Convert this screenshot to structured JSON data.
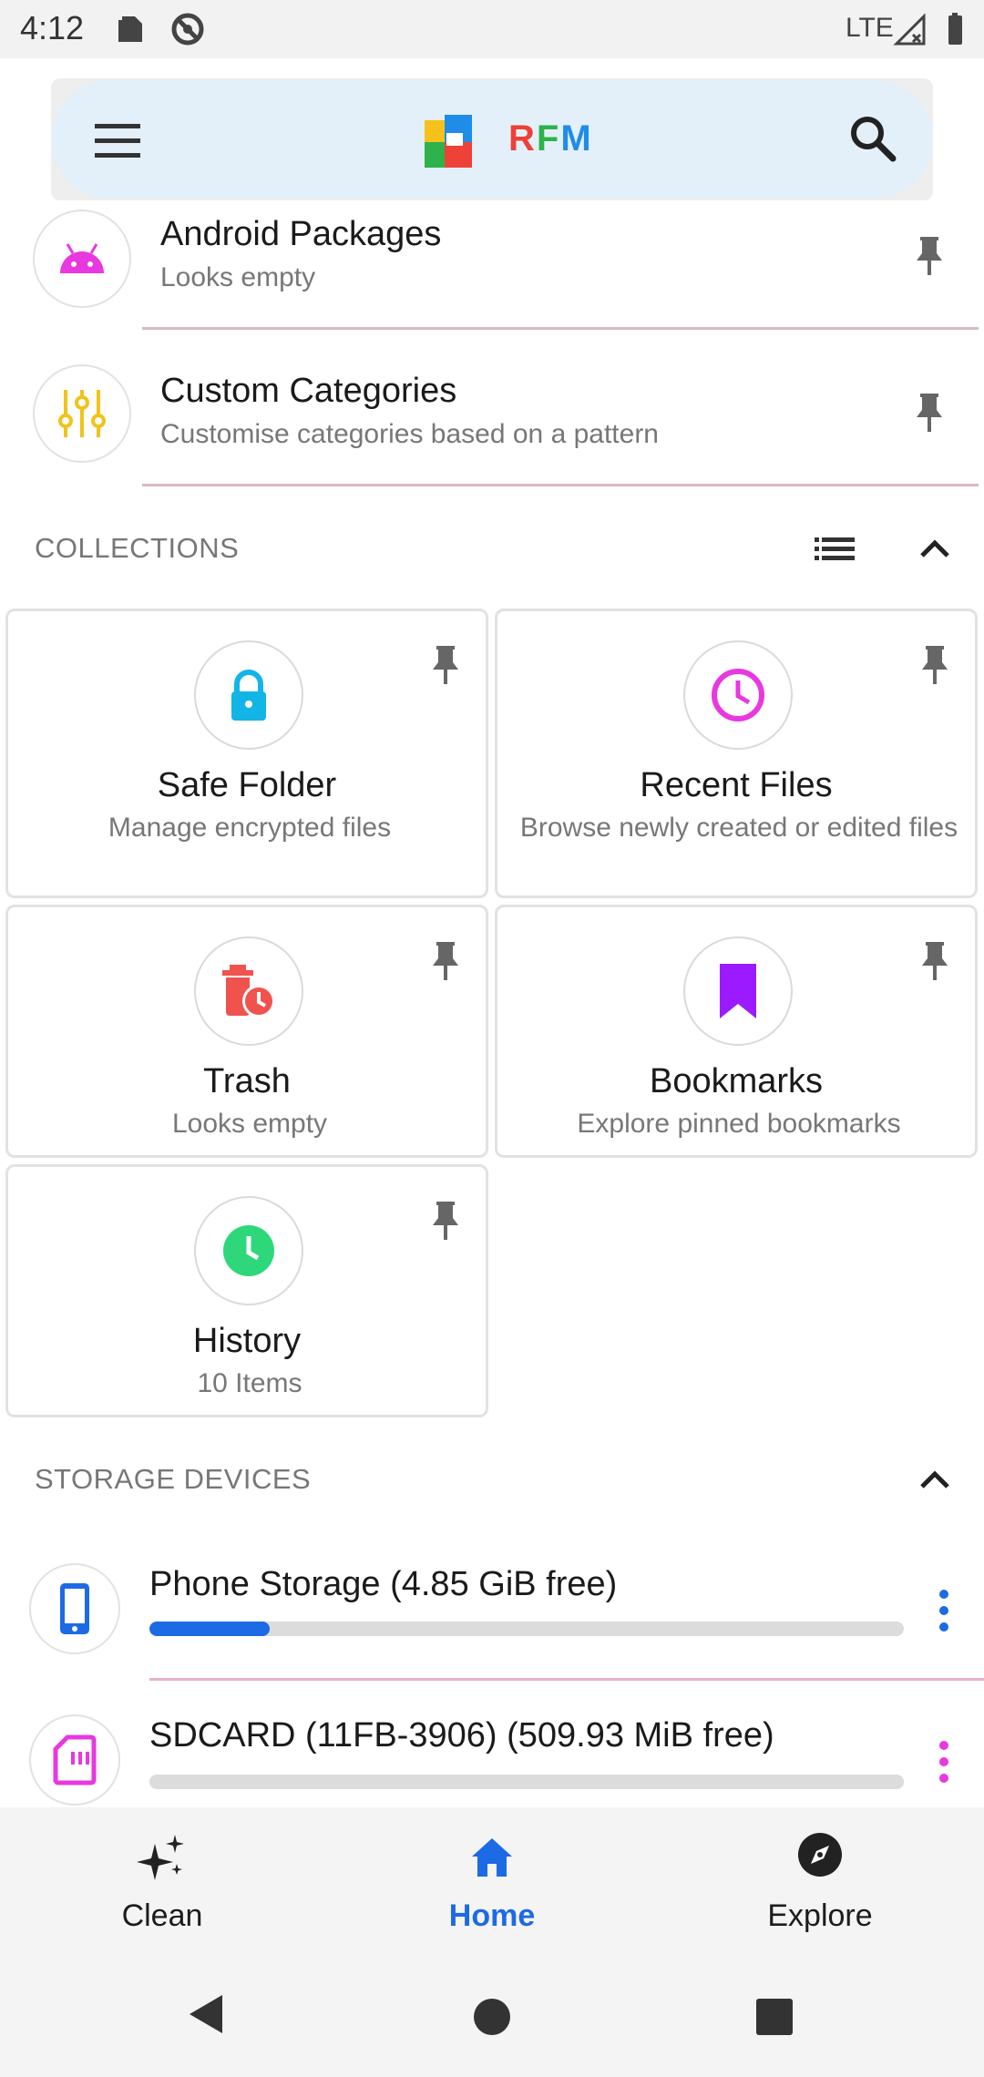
{
  "status_bar": {
    "time": "4:12",
    "network": "LTE",
    "icons": [
      "sim-card-icon",
      "at-sign-icon",
      "signal-icon",
      "battery-icon"
    ]
  },
  "app_bar": {
    "title": "RFM",
    "icons": [
      "menu-icon",
      "app-logo-icon",
      "search-icon"
    ]
  },
  "categories": [
    {
      "title": "Android Packages",
      "subtitle": "Looks empty",
      "icon": "android-icon"
    },
    {
      "title": "Custom Categories",
      "subtitle": "Customise categories based on a pattern",
      "icon": "sliders-icon"
    }
  ],
  "collections": {
    "header": "COLLECTIONS",
    "items": [
      {
        "title": "Safe Folder",
        "subtitle": "Manage encrypted files",
        "icon": "lock-icon"
      },
      {
        "title": "Recent Files",
        "subtitle": "Browse newly created or edited files",
        "icon": "clock-icon"
      },
      {
        "title": "Trash",
        "subtitle": "Looks empty",
        "icon": "trash-clock-icon"
      },
      {
        "title": "Bookmarks",
        "subtitle": "Explore pinned bookmarks",
        "icon": "bookmark-icon"
      },
      {
        "title": "History",
        "subtitle": "10 Items",
        "icon": "history-icon"
      }
    ]
  },
  "storage": {
    "header": "STORAGE DEVICES",
    "devices": [
      {
        "title": "Phone Storage (4.85 GiB free)",
        "used_fraction": 0.16,
        "icon": "phone-icon"
      },
      {
        "title": "SDCARD (11FB-3906) (509.93 MiB free)",
        "used_fraction": 0.0,
        "icon": "sd-card-icon"
      }
    ]
  },
  "bottom_nav": {
    "items": [
      {
        "label": "Clean",
        "icon": "sparkles-icon",
        "active": false
      },
      {
        "label": "Home",
        "icon": "home-icon",
        "active": true
      },
      {
        "label": "Explore",
        "icon": "compass-icon",
        "active": false
      }
    ]
  },
  "colors": {
    "accent": "#1d6ae5",
    "app_bar_bg": "#e3f0fa",
    "pink": "#e838e0",
    "purple": "#9b1aff",
    "green": "#2ed87a",
    "cyan": "#13b4e6",
    "red": "#f0534d",
    "yellow": "#f2c21a"
  }
}
